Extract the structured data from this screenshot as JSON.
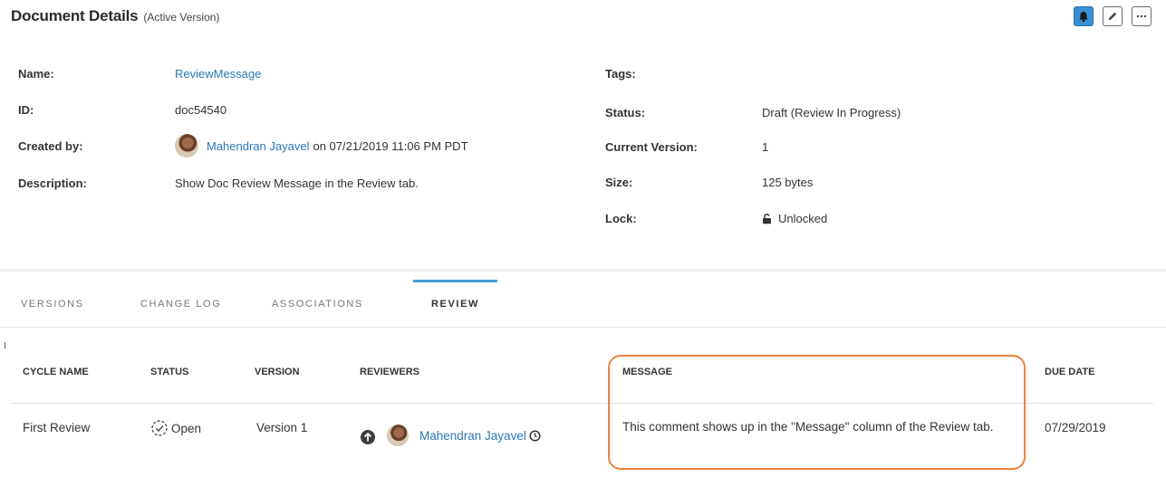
{
  "header": {
    "title": "Document Details",
    "subtitle": "(Active Version)",
    "actions": [
      {
        "icon": "bell-icon"
      },
      {
        "icon": "pencil-icon"
      },
      {
        "icon": "more-icon"
      }
    ]
  },
  "details": {
    "name_label": "Name:",
    "name_value": "ReviewMessage",
    "id_label": "ID:",
    "id_value": "doc54540",
    "created_label": "Created by:",
    "created_user": "Mahendran Jayavel",
    "created_on": "on 07/21/2019 11:06 PM PDT",
    "description_label": "Description:",
    "description_value": "Show Doc Review Message in the Review tab.",
    "tags_label": "Tags:",
    "status_label": "Status:",
    "status_value": "Draft (Review In Progress)",
    "version_label": "Current Version:",
    "version_value": "1",
    "size_label": "Size:",
    "size_value": "125 bytes",
    "lock_label": "Lock:",
    "lock_value": "Unlocked"
  },
  "tabs": [
    {
      "label": "VERSIONS"
    },
    {
      "label": "CHANGE LOG"
    },
    {
      "label": "ASSOCIATIONS"
    },
    {
      "label": "REVIEW"
    }
  ],
  "active_tab": "REVIEW",
  "review_table": {
    "headers": {
      "cycle_name": "CYCLE NAME",
      "status": "STATUS",
      "version": "VERSION",
      "reviewers": "REVIEWERS",
      "message": "MESSAGE",
      "due_date": "DUE DATE"
    },
    "rows": [
      {
        "cycle_name": "First Review",
        "status": "Open",
        "version": "Version 1",
        "reviewer": "Mahendran Jayavel",
        "message": "This comment shows up in the \"Message\" column of the Review tab.",
        "due_date": "07/29/2019"
      }
    ]
  },
  "colors": {
    "link": "#2a79b5",
    "accent": "#4a9cd6",
    "highlight": "#f0813a"
  }
}
